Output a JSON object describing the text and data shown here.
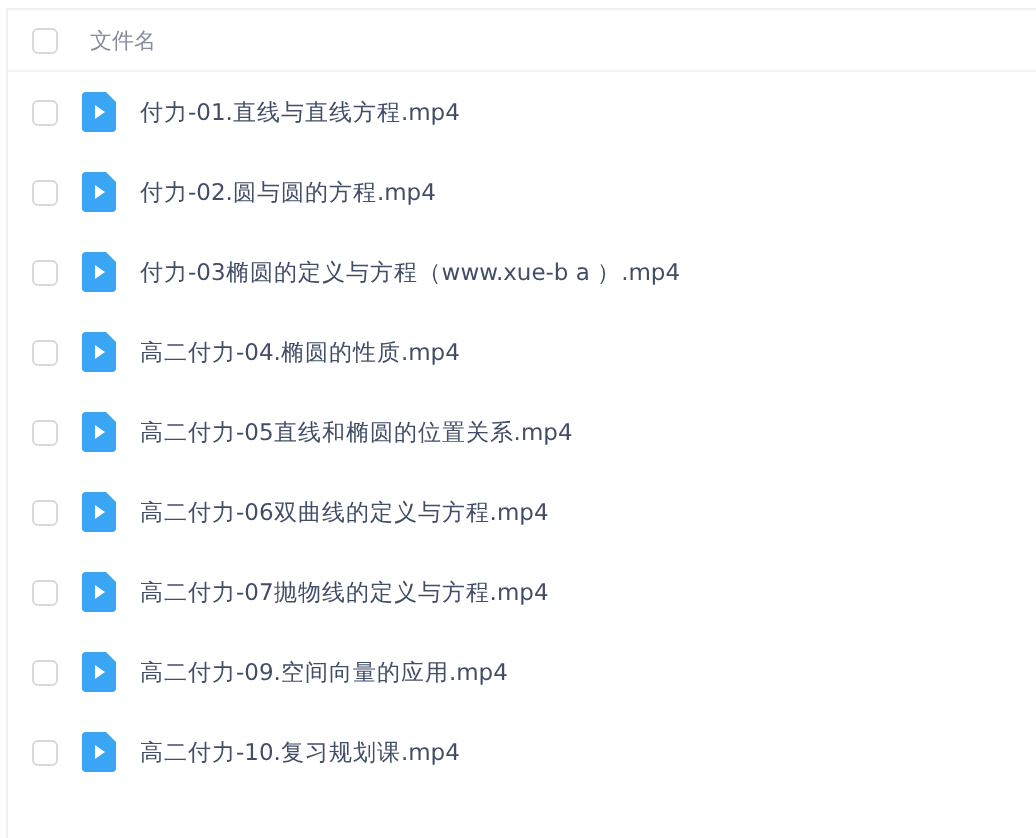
{
  "header": {
    "checked": false,
    "label": "文件名"
  },
  "files": [
    {
      "name": "付力-01.直线与直线方程.mp4",
      "checked": false
    },
    {
      "name": "付力-02.圆与圆的方程.mp4",
      "checked": false
    },
    {
      "name": "付力-03椭圆的定义与方程（www.xue-b a ）.mp4",
      "checked": false
    },
    {
      "name": "高二付力-04.椭圆的性质.mp4",
      "checked": false
    },
    {
      "name": "高二付力-05直线和椭圆的位置关系.mp4",
      "checked": false
    },
    {
      "name": "高二付力-06双曲线的定义与方程.mp4",
      "checked": false
    },
    {
      "name": "高二付力-07抛物线的定义与方程.mp4",
      "checked": false
    },
    {
      "name": "高二付力-09.空间向量的应用.mp4",
      "checked": false
    },
    {
      "name": "高二付力-10.复习规划课.mp4",
      "checked": false
    }
  ]
}
